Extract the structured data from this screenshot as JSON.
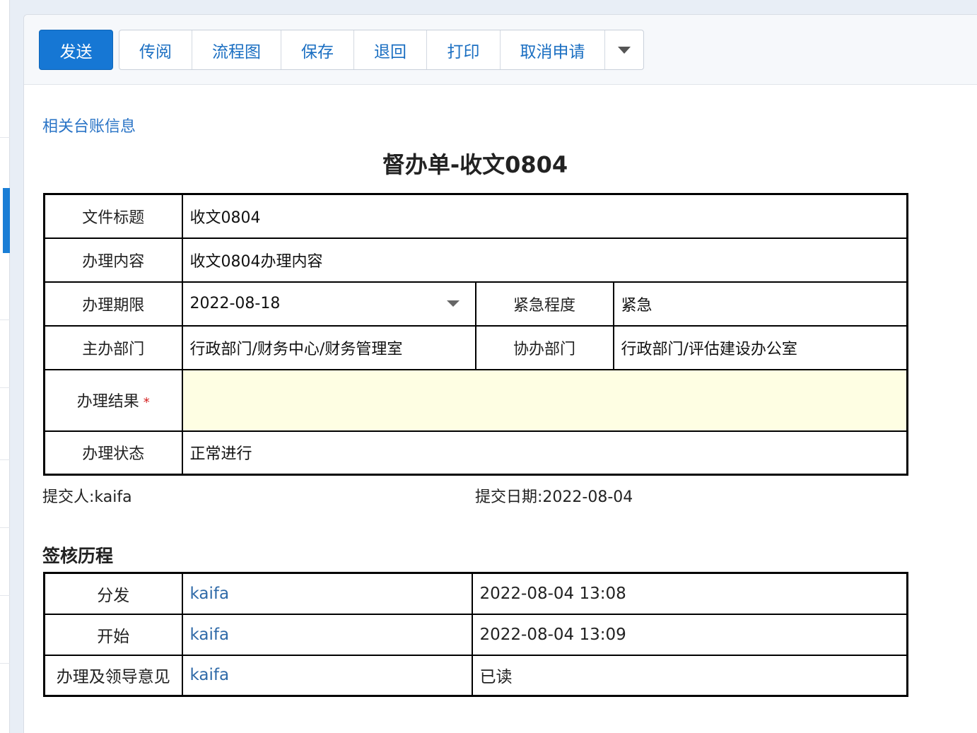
{
  "toolbar": {
    "send_label": "发送",
    "buttons": [
      "传阅",
      "流程图",
      "保存",
      "退回",
      "打印",
      "取消申请"
    ]
  },
  "links": {
    "ledger": "相关台账信息"
  },
  "form": {
    "title": "督办单-收文0804",
    "doc_title_label": "文件标题",
    "doc_title_value": "收文0804",
    "content_label": "办理内容",
    "content_value": "收文0804办理内容",
    "deadline_label": "办理期限",
    "deadline_value": "2022-08-18",
    "urgency_label": "紧急程度",
    "urgency_value": "紧急",
    "lead_dept_label": "主办部门",
    "lead_dept_value": "行政部门/财务中心/财务管理室",
    "assist_dept_label": "协办部门",
    "assist_dept_value": "行政部门/评估建设办公室",
    "result_label": "办理结果",
    "result_required": "*",
    "result_value": "",
    "status_label": "办理状态",
    "status_value": "正常进行"
  },
  "meta": {
    "submitter_label": "提交人:",
    "submitter": "kaifa",
    "submit_date_label": "提交日期:",
    "submit_date": "2022-08-04"
  },
  "history": {
    "title": "签核历程",
    "rows": [
      {
        "step": "分发",
        "user": "kaifa",
        "info": "2022-08-04 13:08"
      },
      {
        "step": "开始",
        "user": "kaifa",
        "info": "2022-08-04 13:09"
      },
      {
        "step": "办理及领导意见",
        "user": "kaifa",
        "info": "已读"
      }
    ]
  },
  "colors": {
    "primary": "#1677d4",
    "link": "#2a74c6",
    "required": "#d42020",
    "result_bg": "#fefee3",
    "read_status": "#1327c6"
  },
  "icons": {
    "more": "chevron-down-icon",
    "deadline": "dropdown-caret-icon"
  }
}
